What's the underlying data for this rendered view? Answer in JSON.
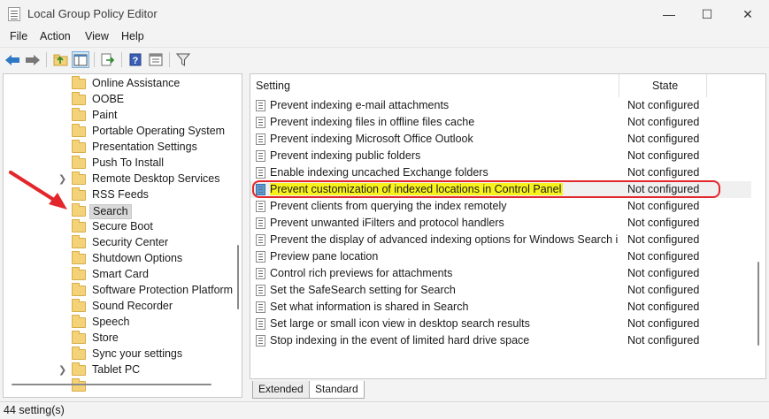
{
  "window": {
    "title": "Local Group Policy Editor",
    "minimize_glyph": "—",
    "maximize_glyph": "☐",
    "close_glyph": "✕"
  },
  "menu": [
    "File",
    "Action",
    "View",
    "Help"
  ],
  "toolbar": {
    "icons": [
      "back-arrow-icon",
      "forward-arrow-icon",
      "up-folder-icon",
      "show-hide-tree-icon",
      "export-list-icon",
      "help-icon",
      "properties-icon",
      "filter-icon"
    ]
  },
  "tree": {
    "items": [
      {
        "label": "Online Assistance",
        "expandable": false
      },
      {
        "label": "OOBE",
        "expandable": false
      },
      {
        "label": "Paint",
        "expandable": false
      },
      {
        "label": "Portable Operating System",
        "expandable": false
      },
      {
        "label": "Presentation Settings",
        "expandable": false
      },
      {
        "label": "Push To Install",
        "expandable": false
      },
      {
        "label": "Remote Desktop Services",
        "expandable": true
      },
      {
        "label": "RSS Feeds",
        "expandable": false
      },
      {
        "label": "Search",
        "expandable": false,
        "selected": true
      },
      {
        "label": "Secure Boot",
        "expandable": false
      },
      {
        "label": "Security Center",
        "expandable": false
      },
      {
        "label": "Shutdown Options",
        "expandable": false
      },
      {
        "label": "Smart Card",
        "expandable": false
      },
      {
        "label": "Software Protection Platform",
        "expandable": false
      },
      {
        "label": "Sound Recorder",
        "expandable": false
      },
      {
        "label": "Speech",
        "expandable": false
      },
      {
        "label": "Store",
        "expandable": false
      },
      {
        "label": "Sync your settings",
        "expandable": false
      },
      {
        "label": "Tablet PC",
        "expandable": true
      }
    ]
  },
  "list": {
    "columns": {
      "setting": "Setting",
      "state": "State"
    },
    "rows": [
      {
        "setting": "Prevent indexing e-mail attachments",
        "state": "Not configured"
      },
      {
        "setting": "Prevent indexing files in offline files cache",
        "state": "Not configured"
      },
      {
        "setting": "Prevent indexing Microsoft Office Outlook",
        "state": "Not configured"
      },
      {
        "setting": "Prevent indexing public folders",
        "state": "Not configured"
      },
      {
        "setting": "Enable indexing uncached Exchange folders",
        "state": "Not configured"
      },
      {
        "setting": "Prevent customization of indexed locations in Control Panel",
        "state": "Not configured",
        "selected": true
      },
      {
        "setting": "Prevent clients from querying the index remotely",
        "state": "Not configured"
      },
      {
        "setting": "Prevent unwanted iFilters and protocol handlers",
        "state": "Not configured"
      },
      {
        "setting": "Prevent the display of advanced indexing options for Windows Search in ...",
        "state": "Not configured"
      },
      {
        "setting": "Preview pane location",
        "state": "Not configured"
      },
      {
        "setting": "Control rich previews for attachments",
        "state": "Not configured"
      },
      {
        "setting": "Set the SafeSearch setting for Search",
        "state": "Not configured"
      },
      {
        "setting": "Set what information is shared in Search",
        "state": "Not configured"
      },
      {
        "setting": "Set large or small icon view in desktop search results",
        "state": "Not configured"
      },
      {
        "setting": "Stop indexing in the event of limited hard drive space",
        "state": "Not configured"
      }
    ]
  },
  "tabs": [
    {
      "label": "Extended",
      "active": false
    },
    {
      "label": "Standard",
      "active": true
    }
  ],
  "status": {
    "text": "44 setting(s)"
  },
  "colors": {
    "highlight": "#f7f21c",
    "annotation_red": "#e3262b",
    "folder": "#f4d27a"
  }
}
